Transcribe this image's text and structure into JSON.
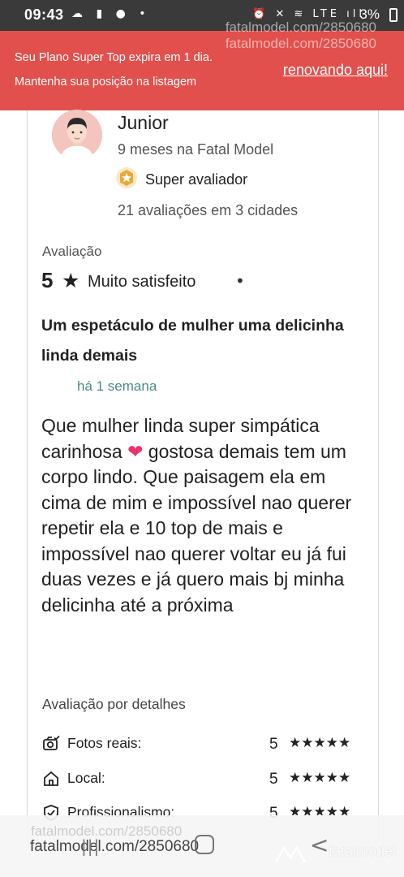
{
  "status_bar": {
    "time": "09:43",
    "left_icons": "☁ ▮ ● •",
    "right_icons": "⏰ ✕ ≋ LTE ıll",
    "battery": "3%"
  },
  "banner": {
    "line1": "Seu Plano Super Top expira em 1 dia.",
    "line2": "Mantenha sua posição na listagem",
    "renew_link": "renovando aqui!",
    "watermark": "fatalmodel.com/2850680",
    "color": "#e1504c"
  },
  "reviewer": {
    "name": "Junior",
    "since": "9 meses na Fatal Model",
    "badge": "Super avaliador",
    "reviews_count": "21 avaliações em 3 cidades",
    "avatar_icon": "person-avatar-icon",
    "badge_icon": "star-hexagon-icon"
  },
  "rating": {
    "caption": "Avaliação",
    "value": "5",
    "star": "★",
    "label": "Muito satisfeito",
    "dot": "•"
  },
  "review": {
    "title": "Um espetáculo de mulher uma delicinha linda demais",
    "time": "há 1 semana",
    "body_before_heart": "Que mulher linda super simpática carinhosa ",
    "heart": "❤",
    "body_after_heart": " gostosa demais tem um corpo lindo. Que paisagem ela em cima de mim e impossível nao querer repetir ela e 10 top de mais e impossível nao querer voltar eu já fui duas vezes e já quero mais bj minha delicinha até a próxima"
  },
  "details": {
    "caption": "Avaliação por detalhes",
    "items": [
      {
        "label": "Fotos reais:",
        "value": "5",
        "stars": "★★★★★",
        "icon": "camera-check-icon"
      },
      {
        "label": "Local:",
        "value": "5",
        "stars": "★★★★★",
        "icon": "home-icon"
      },
      {
        "label": "Profissionalismo:",
        "value": "5",
        "stars": "★★★★★",
        "icon": "shield-check-icon"
      }
    ]
  },
  "bottom": {
    "watermark_faint": "fatalmodel.com/2850680",
    "watermark": "fatalmodel.com/2850680",
    "nav_recent": "|||",
    "nav_back": "<",
    "brand": "fatalmodel"
  }
}
